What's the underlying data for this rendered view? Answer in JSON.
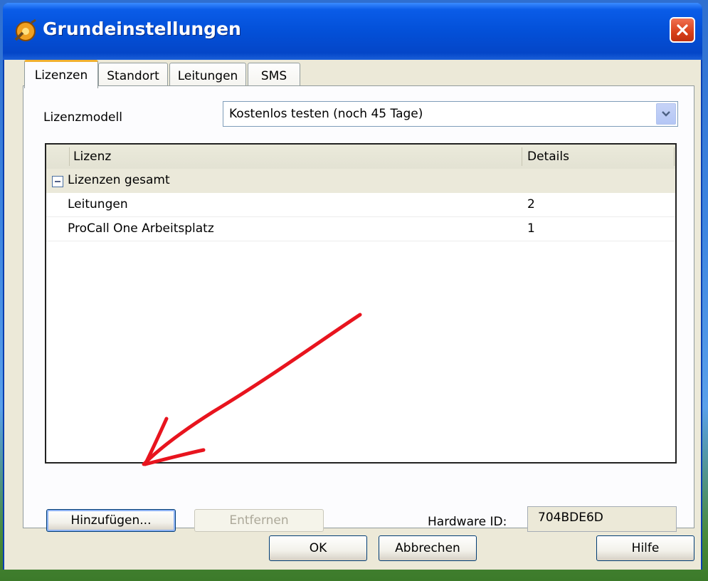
{
  "window": {
    "title": "Grundeinstellungen",
    "close_symbol": "✕"
  },
  "tabs": [
    {
      "label": "Lizenzen",
      "active": true
    },
    {
      "label": "Standort",
      "active": false
    },
    {
      "label": "Leitungen",
      "active": false
    },
    {
      "label": "SMS",
      "active": false
    }
  ],
  "license_model": {
    "label": "Lizenzmodell",
    "value": "Kostenlos testen (noch 45 Tage)"
  },
  "license_table": {
    "columns": [
      "Lizenz",
      "Details"
    ],
    "group": {
      "label": "Lizenzen gesamt",
      "expanded": true
    },
    "rows": [
      {
        "lizenz": "Leitungen",
        "details": "2"
      },
      {
        "lizenz": "ProCall One Arbeitsplatz",
        "details": "1"
      }
    ]
  },
  "actions": {
    "add_label": "Hinzufügen...",
    "remove_label": "Entfernen"
  },
  "hardware": {
    "label": "Hardware ID:",
    "value": "704BDE6D"
  },
  "footer": {
    "ok_label": "OK",
    "cancel_label": "Abbrechen",
    "help_label": "Hilfe"
  },
  "colors": {
    "titlebar": "#0350d8",
    "tab_highlight": "#f0b030",
    "annotation_arrow": "#e8141e"
  }
}
